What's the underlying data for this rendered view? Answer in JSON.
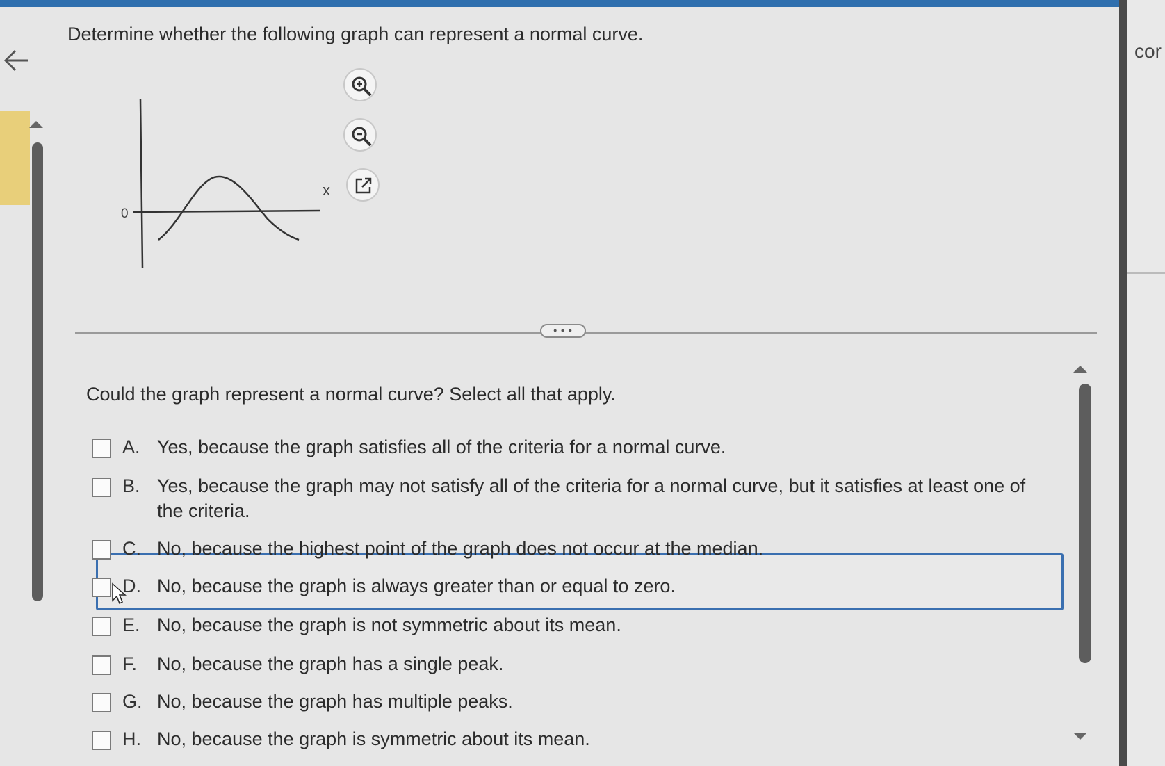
{
  "question": {
    "title": "Determine whether the following graph can represent a normal curve."
  },
  "graph": {
    "axis_x_label": "x",
    "axis_y_zero_label": "0"
  },
  "tools": {
    "zoom_in": "zoom-in-icon",
    "zoom_out": "zoom-out-icon",
    "popout": "external-link-icon"
  },
  "more_button_label": "• • •",
  "prompt": "Could the graph represent a normal curve? Select all that apply.",
  "options": [
    {
      "letter": "A.",
      "text": "Yes, because the graph satisfies all of the criteria for a normal curve.",
      "checked": false
    },
    {
      "letter": "B.",
      "text": "Yes, because the graph may not satisfy all of the criteria for a normal curve, but it satisfies at least one of the criteria.",
      "checked": false
    },
    {
      "letter": "C.",
      "text": "No, because the highest point of the graph does not occur at the median.",
      "checked": false
    },
    {
      "letter": "D.",
      "text": "No, because the graph is always greater than or equal to zero.",
      "checked": false
    },
    {
      "letter": "E.",
      "text": "No, because the graph is not symmetric about its mean.",
      "checked": false
    },
    {
      "letter": "F.",
      "text": "No, because the graph has a single peak.",
      "checked": false
    },
    {
      "letter": "G.",
      "text": "No, because the graph has multiple peaks.",
      "checked": false
    },
    {
      "letter": "H.",
      "text": "No, because the graph is symmetric about its mean.",
      "checked": false
    }
  ],
  "right_panel_partial_text": "cor"
}
